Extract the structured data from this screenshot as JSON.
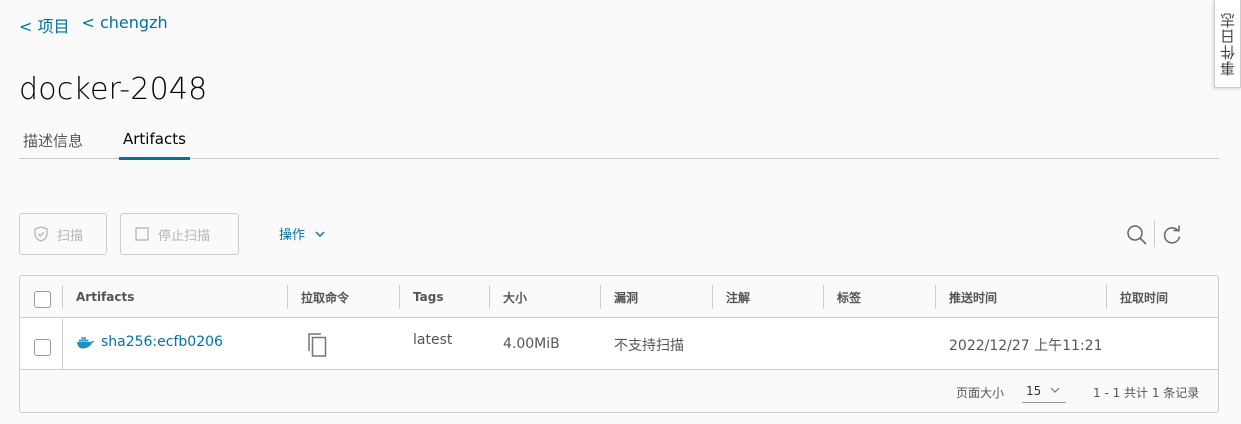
{
  "breadcrumb": {
    "projects": "< 项目",
    "project": "< chengzh"
  },
  "page": {
    "title": "docker-2048"
  },
  "tabs": [
    {
      "label": "描述信息"
    },
    {
      "label": "Artifacts"
    }
  ],
  "drawer": {
    "event_log_label": "事件日志"
  },
  "toolbar": {
    "scan_label": "扫描",
    "stop_scan_label": "停止扫描",
    "actions_label": "操作"
  },
  "table": {
    "headers": [
      "Artifacts",
      "拉取命令",
      "Tags",
      "大小",
      "漏洞",
      "注解",
      "标签",
      "推送时间",
      "拉取时间"
    ],
    "rows": [
      {
        "artifact": "sha256:ecfb0206",
        "tags": "latest",
        "size": "4.00MiB",
        "vulnerabilities": "不支持扫描",
        "annotations": "",
        "labels": "",
        "push_time": "2022/12/27 上午11:21",
        "pull_time": ""
      }
    ]
  },
  "pagination": {
    "page_size_label": "页面大小",
    "page_size_value": "15",
    "summary": "1 - 1 共计 1 条记录"
  },
  "colors": {
    "link": "#0072a3",
    "border": "#cccccc",
    "disabled": "#b5b5b5",
    "background": "#fafafa"
  }
}
